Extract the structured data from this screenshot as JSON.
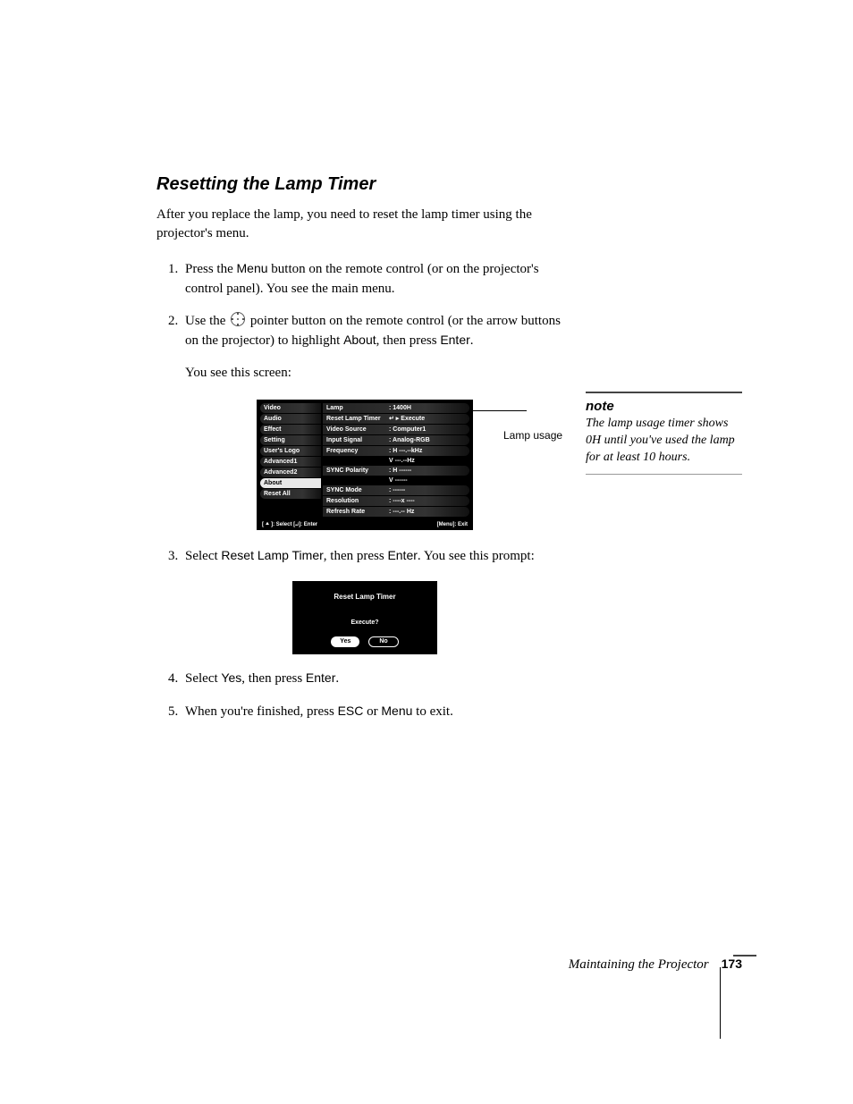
{
  "heading": "Resetting the Lamp Timer",
  "intro": "After you replace the lamp, you need to reset the lamp timer using the projector's menu.",
  "steps": {
    "s1_a": "Press the ",
    "s1_menu": "Menu",
    "s1_b": " button on the remote control (or on the projector's control panel). You see the main menu.",
    "s2_a": "Use the ",
    "s2_b": " pointer button on the remote control (or the arrow buttons on the projector) to highlight ",
    "s2_about": "About",
    "s2_c": ", then press ",
    "s2_enter": "Enter",
    "s2_d": ".",
    "s2_e": "You see this screen:",
    "s3_a": "Select ",
    "s3_reset": "Reset Lamp Timer",
    "s3_b": ", then press ",
    "s3_enter": "Enter",
    "s3_c": ". You see this prompt:",
    "s4_a": "Select ",
    "s4_yes": "Yes",
    "s4_b": ", then press ",
    "s4_enter": "Enter",
    "s4_c": ".",
    "s5_a": "When you're finished, press ",
    "s5_esc": "ESC",
    "s5_b": " or ",
    "s5_menu": "Menu",
    "s5_c": " to exit."
  },
  "menu": {
    "left": [
      "Video",
      "Audio",
      "Effect",
      "Setting",
      "User's Logo",
      "Advanced1",
      "Advanced2",
      "About",
      "Reset All"
    ],
    "right": [
      {
        "lbl": "Lamp",
        "val": ": 1400H"
      },
      {
        "lbl": "Reset Lamp Timer",
        "val": "↵ ▸ Execute"
      },
      {
        "lbl": "Video Source",
        "val": ": Computer1"
      },
      {
        "lbl": "Input Signal",
        "val": ": Analog-RGB"
      },
      {
        "lbl": "Frequency",
        "val": ": H ---.--kHz"
      },
      {
        "lbl": "",
        "val": "V ---.--Hz",
        "sub": true
      },
      {
        "lbl": "SYNC Polarity",
        "val": ": H ------"
      },
      {
        "lbl": "",
        "val": "V ------",
        "sub": true
      },
      {
        "lbl": "SYNC Mode",
        "val": ": ------"
      },
      {
        "lbl": "Resolution",
        "val": ": ----x ----"
      },
      {
        "lbl": "Refresh Rate",
        "val": ": ---.-- Hz"
      }
    ],
    "foot_left": "[ ⯅ ]: Select   [↵]: Enter",
    "foot_right": "[Menu]: Exit"
  },
  "callout": "Lamp usage",
  "prompt": {
    "title": "Reset Lamp Timer",
    "question": "Execute?",
    "yes": "Yes",
    "no": "No"
  },
  "note": {
    "title": "note",
    "body": "The lamp usage timer shows 0H until you've used the lamp for at least 10 hours."
  },
  "footer": {
    "text": "Maintaining the Projector",
    "page": "173"
  }
}
